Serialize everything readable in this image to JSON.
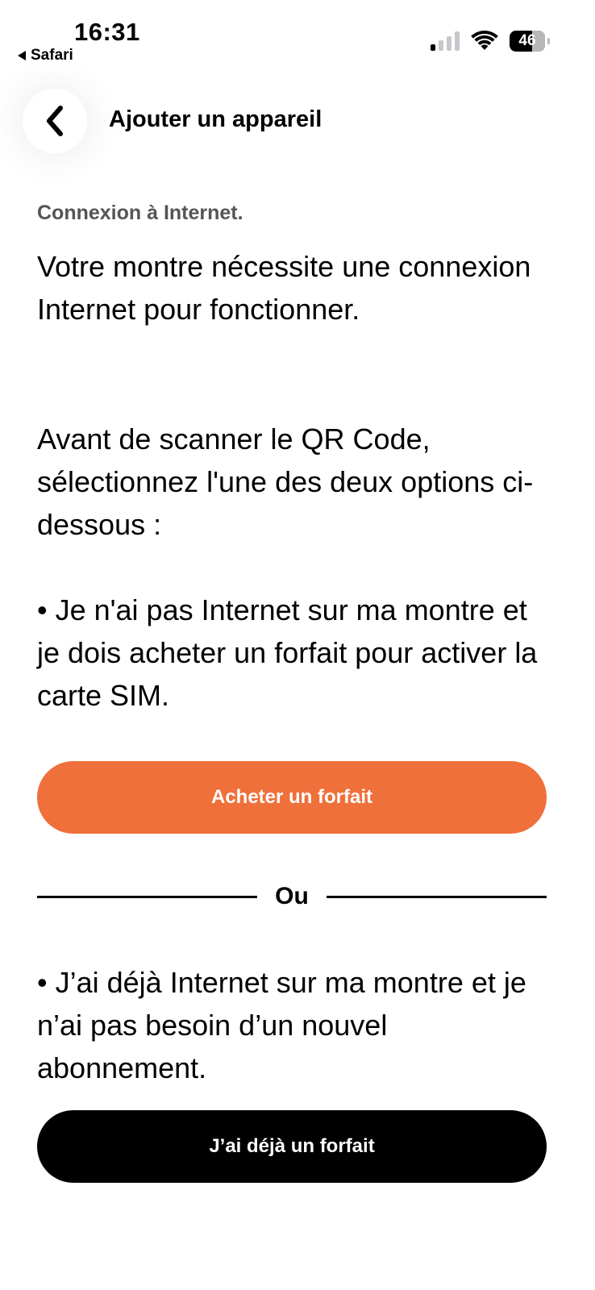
{
  "status_bar": {
    "time": "16:31",
    "back_app": "Safari",
    "battery": "46",
    "icons": [
      "signal-icon",
      "wifi-icon",
      "battery-icon"
    ]
  },
  "header": {
    "title": "Ajouter un appareil",
    "back_icon": "chevron-left-icon"
  },
  "main": {
    "section_label": "Connexion à Internet.",
    "intro": "Votre montre nécessite une connexion Internet pour fonctionner.",
    "instruction": "Avant de scanner le QR Code, sélectionnez l'une des deux options ci-dessous :",
    "option1": "• Je n'ai pas Internet sur ma montre et je dois acheter un forfait pour activer la carte SIM.",
    "buy_button": "Acheter un forfait",
    "divider_label": "Ou",
    "option2": "• J’ai déjà Internet sur ma montre et je n’ai pas besoin d’un nouvel abonnement.",
    "have_plan_button": "J’ai déjà un forfait"
  },
  "colors": {
    "accent": "#ef703a",
    "primary_button": "#000000",
    "label_gray": "#555555"
  }
}
